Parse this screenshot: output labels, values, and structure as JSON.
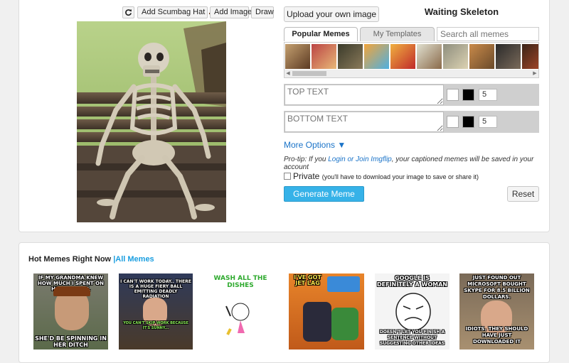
{
  "toolbar": {
    "rotate_icon": "rotate-icon",
    "add_hat_label": "Add Scumbag Hat",
    "add_image_label": "Add Image",
    "draw_label": "Draw"
  },
  "upload_label": "Upload your own image",
  "meme_title": "Waiting Skeleton",
  "tabs": [
    {
      "label": "Popular Memes",
      "active": true
    },
    {
      "label": "My Templates",
      "active": false
    }
  ],
  "search": {
    "placeholder": "Search all memes",
    "value": ""
  },
  "text_boxes": [
    {
      "placeholder": "TOP TEXT",
      "font_size": "5",
      "fill_color": "#ffffff",
      "outline_color": "#000000"
    },
    {
      "placeholder": "BOTTOM TEXT",
      "font_size": "5",
      "fill_color": "#ffffff",
      "outline_color": "#000000"
    }
  ],
  "more_options_label": "More Options ▼",
  "protip": {
    "prefix": "Pro-tip: If you ",
    "link": "Login or Join Imgflip",
    "suffix": ", your captioned memes will be saved in your account"
  },
  "private": {
    "label": "Private",
    "note": "(you'll have to download your image to save or share it)",
    "checked": false
  },
  "generate_label": "Generate Meme",
  "reset_label": "Reset",
  "hot": {
    "heading": "Hot Memes Right Now",
    "link": "All Memes",
    "items": [
      {
        "top": "If my grandma knew how much I spent on her funeral",
        "bottom": "She'd be spinning in her ditch"
      },
      {
        "top": "I can't work today.. there is a huge fiery ball emitting deadly radiation",
        "bottom": "You can't skip work because it's sunny..."
      },
      {
        "top": "Wash all the dishes",
        "bottom": ""
      },
      {
        "top": "I've got jet lag",
        "bottom": ""
      },
      {
        "top": "Google is definitely a woman",
        "bottom": "Doesn't let you finish a sentence without suggesting other ideas"
      },
      {
        "top": "Just found out Microsoft bought Skype for 8.5 billion dollars.",
        "bottom": "Idiots. They should have just downloaded it"
      }
    ]
  }
}
